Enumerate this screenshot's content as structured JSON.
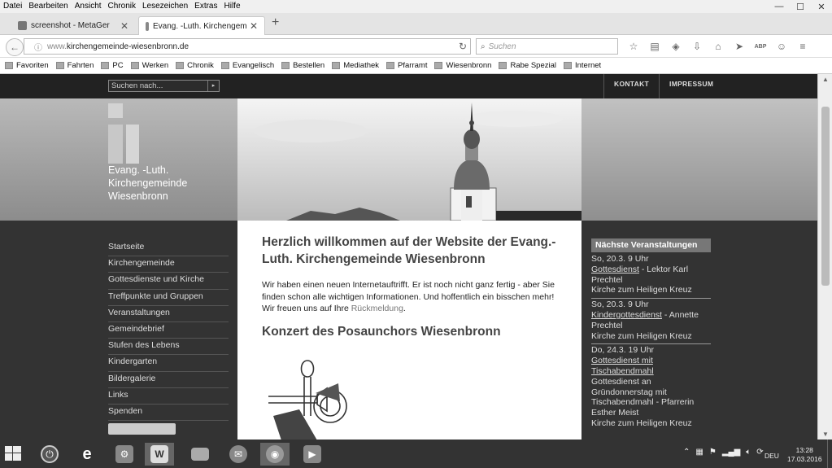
{
  "menubar": {
    "items": [
      "Datei",
      "Bearbeiten",
      "Ansicht",
      "Chronik",
      "Lesezeichen",
      "Extras",
      "Hilfe"
    ]
  },
  "window_controls": {
    "minimize": "—",
    "maximize": "☐",
    "close": "✕"
  },
  "tabs": [
    {
      "label": "screenshot - MetaGer",
      "close": "✕"
    },
    {
      "label": "Evang. -Luth. Kirchengem...",
      "close": "✕"
    }
  ],
  "new_tab": "+",
  "navbar": {
    "back": "←",
    "info": "ⓘ",
    "url_www": "www.",
    "url_rest": "kirchengemeinde-wiesenbronn.de",
    "reload": "↻",
    "search_placeholder": "Suchen",
    "search_icon": "⌕",
    "icons": [
      "☆",
      "▤",
      "◈",
      "⇩",
      "⌂",
      "➤",
      "ABP",
      "☺",
      "≡"
    ]
  },
  "bookmarks": [
    "Favoriten",
    "Fahrten",
    "PC",
    "Werken",
    "Chronik",
    "Evangelisch",
    "Bestellen",
    "Mediathek",
    "Pfarramt",
    "Wiesenbronn",
    "Rabe Spezial",
    "Internet"
  ],
  "site": {
    "search_placeholder": "Suchen nach...",
    "search_go": "▸",
    "top_links": [
      "KONTAKT",
      "IMPRESSUM"
    ],
    "title_lines": [
      "Evang. -Luth.",
      "Kirchengemeinde",
      "Wiesenbronn"
    ],
    "nav": [
      "Startseite",
      "Kirchengemeinde",
      "Gottesdienste und Kirche",
      "Treffpunkte und Gruppen",
      "Veranstaltungen",
      "Gemeindebrief",
      "Stufen des Lebens",
      "Kindergarten",
      "Bildergalerie",
      "Links",
      "Spenden"
    ],
    "welcome_heading": "Herzlich willkommen auf der Website der Evang.-Luth. Kirchengemeinde Wiesenbronn",
    "intro_text": "Wir haben einen neuen Internetauftrifft. Er ist noch nicht ganz fertig - aber Sie finden schon alle wichtigen Informationen. Und hoffentlich ein bisschen mehr! Wir freuen uns auf Ihre ",
    "intro_link": "Rückmeldung",
    "intro_end": ".",
    "concert_heading": "Konzert des Posaunchors Wiesenbronn",
    "events_heading": "Nächste Veranstaltungen",
    "events": [
      {
        "date": "So, 20.3. 9 Uhr",
        "link": "Gottesdienst",
        "rest": " - Lektor Karl Prechtel",
        "place": "Kirche zum Heiligen Kreuz"
      },
      {
        "date": "So, 20.3. 9 Uhr",
        "link": "Kindergottesdienst",
        "rest": " - Annette Prechtel",
        "place": "Kirche zum Heiligen Kreuz"
      },
      {
        "date": "Do, 24.3. 19 Uhr",
        "link": "Gottesdienst mit Tischabendmahl",
        "rest": "Gottesdienst an Gründonnerstag mit Tischabendmahl - Pfarrerin Esther Meist",
        "place": "Kirche zum Heiligen Kreuz"
      }
    ]
  },
  "taskbar": {
    "language": "DEU",
    "time": "13:28",
    "date": "17.03.2016",
    "apps": [
      "power",
      "ie",
      "settings",
      "word",
      "explorer",
      "thunderbird",
      "firefox",
      "media"
    ]
  }
}
